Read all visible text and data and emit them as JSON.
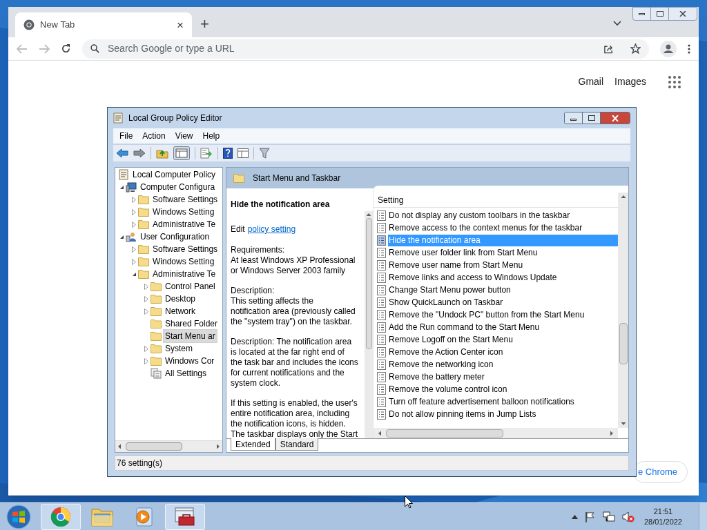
{
  "browser": {
    "tab": {
      "title": "New Tab",
      "close": "×"
    },
    "new_tab_button": "+",
    "omnibox": {
      "placeholder": "Search Google or type a URL"
    },
    "links": [
      "Gmail",
      "Images"
    ],
    "customize_button": "e Chrome"
  },
  "editor": {
    "window": {
      "title": "Local Group Policy Editor"
    },
    "menu": [
      "File",
      "Action",
      "View",
      "Help"
    ],
    "tree": [
      {
        "label": "Local Computer Policy",
        "kind": "policy",
        "selected": false,
        "children": [
          {
            "label": "Computer Configura",
            "kind": "computer",
            "expanded": true,
            "selected": false,
            "children": [
              {
                "label": "Software Settings",
                "kind": "folder",
                "expanded": false,
                "selected": false
              },
              {
                "label": "Windows Setting",
                "kind": "folder",
                "expanded": false,
                "selected": false
              },
              {
                "label": "Administrative Te",
                "kind": "folder",
                "expanded": false,
                "selected": false
              }
            ]
          },
          {
            "label": "User Configuration",
            "kind": "user",
            "expanded": true,
            "selected": false,
            "children": [
              {
                "label": "Software Settings",
                "kind": "folder",
                "expanded": false,
                "selected": false
              },
              {
                "label": "Windows Setting",
                "kind": "folder",
                "expanded": false,
                "selected": false
              },
              {
                "label": "Administrative Te",
                "kind": "folder",
                "expanded": true,
                "selected": false,
                "children": [
                  {
                    "label": "Control Panel",
                    "kind": "folder",
                    "expanded": false,
                    "selected": false
                  },
                  {
                    "label": "Desktop",
                    "kind": "folder",
                    "expanded": false,
                    "selected": false
                  },
                  {
                    "label": "Network",
                    "kind": "folder",
                    "expanded": false,
                    "selected": false
                  },
                  {
                    "label": "Shared Folder",
                    "kind": "folder",
                    "selected": false
                  },
                  {
                    "label": "Start Menu ar",
                    "kind": "folder",
                    "selected": true
                  },
                  {
                    "label": "System",
                    "kind": "folder",
                    "expanded": false,
                    "selected": false
                  },
                  {
                    "label": "Windows Cor",
                    "kind": "folder",
                    "expanded": false,
                    "selected": false
                  },
                  {
                    "label": "All Settings",
                    "kind": "settings",
                    "selected": false
                  }
                ]
              }
            ]
          }
        ]
      }
    ],
    "header": "Start Menu and Taskbar",
    "description": {
      "title": "Hide the notification area",
      "edit_prefix": "Edit",
      "edit_link": "policy setting",
      "paragraphs": [
        [
          "Requirements:",
          "At least Windows XP Professional",
          "or Windows Server 2003 family"
        ],
        [
          "Description:",
          "This setting affects the",
          "notification area (previously called",
          "the \"system tray\") on the taskbar."
        ],
        [
          "Description: The notification area",
          "is located at the far right end of",
          "the task bar and includes the icons",
          "for current notifications and the",
          "system clock."
        ],
        [
          "If this setting is enabled, the user's",
          "entire notification area, including",
          "the notification icons, is hidden.",
          "The taskbar displays only the Start"
        ]
      ]
    },
    "list": {
      "column": "Setting",
      "rows": [
        {
          "label": "Do not display any custom toolbars in the taskbar",
          "selected": false
        },
        {
          "label": "Remove access to the context menus for the taskbar",
          "selected": false
        },
        {
          "label": "Hide the notification area",
          "selected": true
        },
        {
          "label": "Remove user folder link from Start Menu",
          "selected": false
        },
        {
          "label": "Remove user name from Start Menu",
          "selected": false
        },
        {
          "label": "Remove links and access to Windows Update",
          "selected": false
        },
        {
          "label": "Change Start Menu power button",
          "selected": false
        },
        {
          "label": "Show QuickLaunch on Taskbar",
          "selected": false
        },
        {
          "label": "Remove the \"Undock PC\" button from the Start Menu",
          "selected": false
        },
        {
          "label": "Add the Run command to the Start Menu",
          "selected": false
        },
        {
          "label": "Remove Logoff on the Start Menu",
          "selected": false
        },
        {
          "label": "Remove the Action Center icon",
          "selected": false
        },
        {
          "label": "Remove the networking icon",
          "selected": false
        },
        {
          "label": "Remove the battery meter",
          "selected": false
        },
        {
          "label": "Remove the volume control icon",
          "selected": false
        },
        {
          "label": "Turn off feature advertisement balloon notifications",
          "selected": false
        },
        {
          "label": "Do not allow pinning items in Jump Lists",
          "selected": false
        }
      ]
    },
    "tabs": [
      {
        "label": "Extended",
        "selected": true
      },
      {
        "label": "Standard",
        "selected": false
      }
    ],
    "status_bar": "76 setting(s)"
  },
  "taskbar": {
    "apps": [
      {
        "kind": "chrome",
        "active": true
      },
      {
        "kind": "explorer",
        "active": false
      },
      {
        "kind": "media",
        "active": false
      },
      {
        "kind": "toolbox",
        "active": true
      }
    ],
    "time": "21:51",
    "date": "28/01/2022"
  }
}
